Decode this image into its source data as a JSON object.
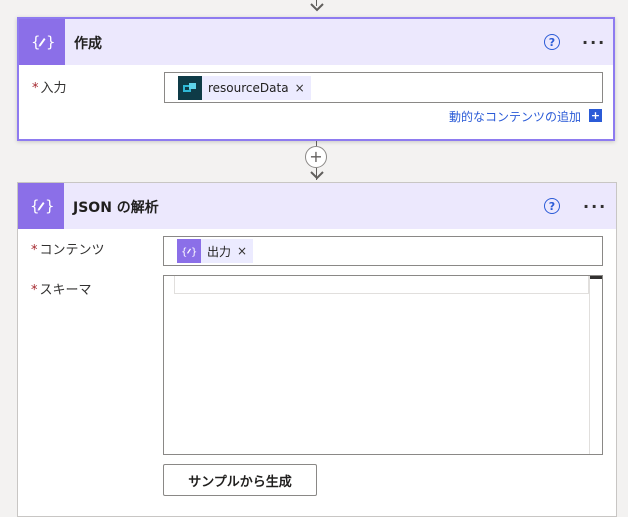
{
  "compose": {
    "title": "作成",
    "input_label": "入力",
    "token_label": "resourceData",
    "token_close": "×",
    "dynamic_content_link": "動的なコンテンツの追加",
    "dynamic_plus": "+",
    "help": "?",
    "more": "···"
  },
  "connector": {
    "add_symbol": "+"
  },
  "parse_json": {
    "title": "JSON の解析",
    "content_label": "コンテンツ",
    "content_token_label": "出力",
    "content_token_close": "×",
    "schema_label": "スキーマ",
    "generate_button": "サンプルから生成",
    "help": "?",
    "more": "···"
  },
  "required_mark": "*",
  "colors": {
    "action_purple": "#8b6fe8",
    "header_bg": "#ece8fd",
    "selected_border": "#8e7bf0",
    "link_blue": "#2b5bd7",
    "required_red": "#a4262c"
  },
  "icons": {
    "compose": "curly-braces-pencil-icon",
    "token": "azure-resource-icon",
    "parse_json": "curly-braces-pencil-icon"
  }
}
